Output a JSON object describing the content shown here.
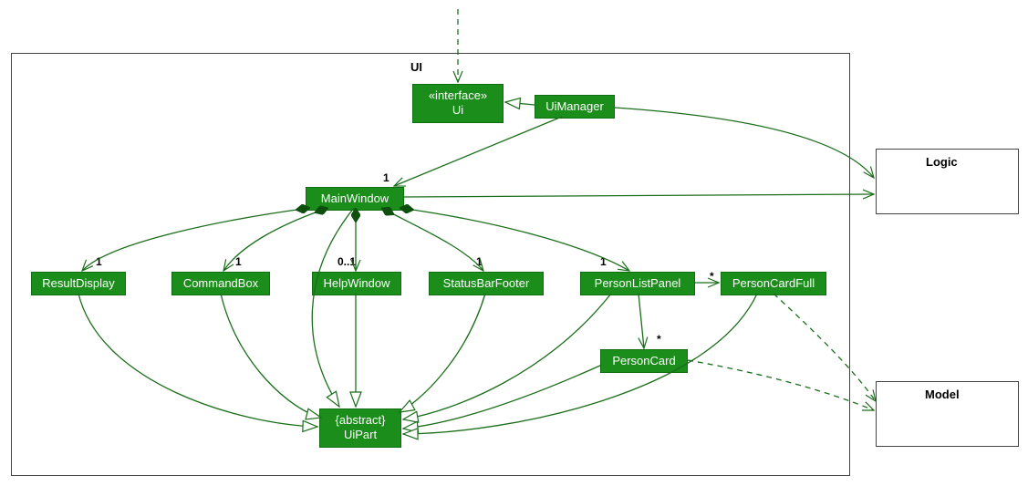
{
  "package": {
    "label": "UI"
  },
  "classes": {
    "ui_interface": {
      "stereotype": "«interface»",
      "name": "Ui"
    },
    "uimanager": {
      "name": "UiManager"
    },
    "mainwindow": {
      "name": "MainWindow"
    },
    "resultdisplay": {
      "name": "ResultDisplay"
    },
    "commandbox": {
      "name": "CommandBox"
    },
    "helpwindow": {
      "name": "HelpWindow"
    },
    "statusbarfooter": {
      "name": "StatusBarFooter"
    },
    "personlistpanel": {
      "name": "PersonListPanel"
    },
    "personcardfull": {
      "name": "PersonCardFull"
    },
    "personcard": {
      "name": "PersonCard"
    },
    "uipart": {
      "stereotype": "{abstract}",
      "name": "UiPart"
    }
  },
  "external": {
    "logic": {
      "name": "Logic"
    },
    "model": {
      "name": "Model"
    }
  },
  "multiplicities": {
    "mw": "1",
    "rd": "1",
    "cb": "1",
    "hw": "0..1",
    "sbf": "1",
    "plp": "1",
    "pcf": "*",
    "pc": "*"
  }
}
